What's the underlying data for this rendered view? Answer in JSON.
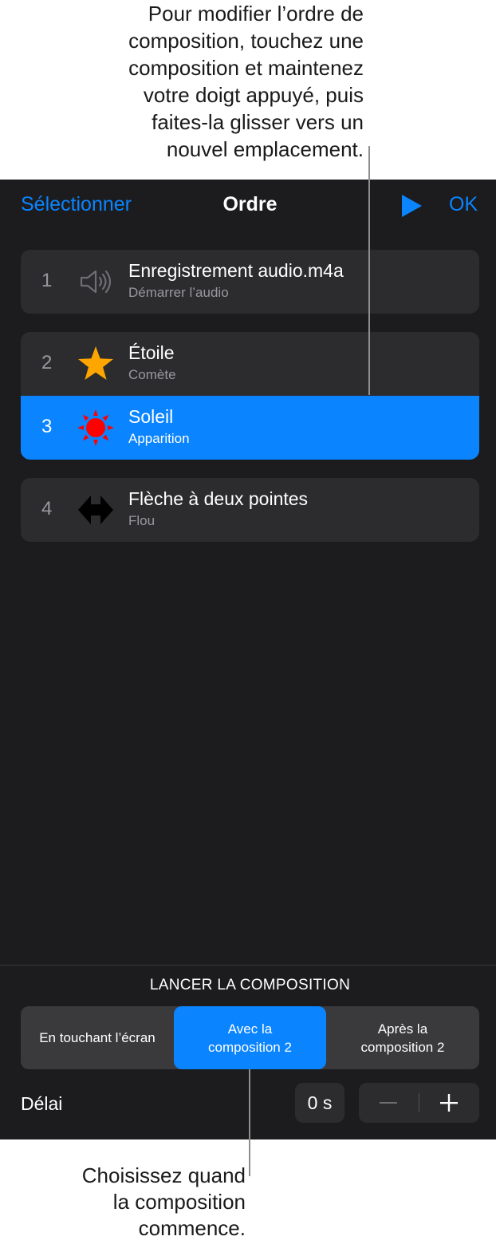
{
  "callouts": {
    "top_lines": [
      "Pour modifier l’ordre de",
      "composition, touchez une",
      "composition et maintenez",
      "votre doigt appuyé, puis",
      "faites-la glisser vers un",
      "nouvel emplacement."
    ],
    "bottom_lines": [
      "Choisissez quand",
      "la composition",
      "commence."
    ]
  },
  "nav": {
    "select_label": "Sélectionner",
    "title": "Ordre",
    "play_icon": "play-icon",
    "ok_label": "OK"
  },
  "builds": [
    {
      "number": "1",
      "icon": "speaker-icon",
      "title": "Enregistrement audio.m4a",
      "subtitle": "Démarrer l’audio",
      "selected": false
    },
    {
      "number": "2",
      "icon": "star-icon",
      "title": "Étoile",
      "subtitle": "Comète",
      "selected": false
    },
    {
      "number": "3",
      "icon": "sun-icon",
      "title": "Soleil",
      "subtitle": "Apparition",
      "selected": true
    },
    {
      "number": "4",
      "icon": "double-arrow-icon",
      "title": "Flèche à deux pointes",
      "subtitle": "Flou",
      "selected": false
    }
  ],
  "launch": {
    "label": "LANCER LA COMPOSITION",
    "options": [
      {
        "line1": "En touchant l’écran",
        "line2": "",
        "selected": false
      },
      {
        "line1": "Avec la",
        "line2": "composition 2",
        "selected": true
      },
      {
        "line1": "Après la",
        "line2": "composition 2",
        "selected": false
      }
    ]
  },
  "delay": {
    "label": "Délai",
    "value": "0 s",
    "minus_icon": "minus-icon",
    "plus_icon": "plus-icon"
  },
  "colors": {
    "accent": "#0a84ff",
    "panel_bg": "#1c1c1e",
    "row_bg": "#2c2c2e",
    "star": "#ffa500",
    "sun": "#ff0000"
  }
}
